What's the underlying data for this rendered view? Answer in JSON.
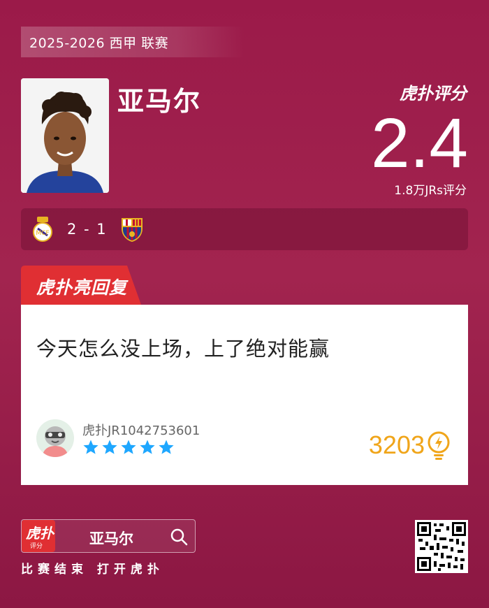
{
  "header": {
    "season": "2025-2026 西甲 联赛"
  },
  "player": {
    "name": "亚马尔"
  },
  "rating": {
    "brand": "虎扑评分",
    "score": "2.4",
    "count_text": "1.8万JRs评分"
  },
  "match": {
    "score": "2 - 1",
    "home_crest": "real-madrid-crest",
    "away_crest": "barcelona-crest"
  },
  "reply": {
    "tab_label": "虎扑亮回复",
    "comment": "今天怎么没上场，上了绝对能赢",
    "username": "虎扑JR1042753601",
    "stars": 5,
    "likes": "3203"
  },
  "footer": {
    "search_text": "亚马尔",
    "app_icon_text": "虎扑",
    "app_icon_sub": "评分",
    "caption": "比赛结束 打开虎扑"
  },
  "colors": {
    "background": "#9b1a49",
    "accent_red": "#e02f33",
    "likes": "#f0a51a",
    "stars": "#1ea7ff"
  }
}
